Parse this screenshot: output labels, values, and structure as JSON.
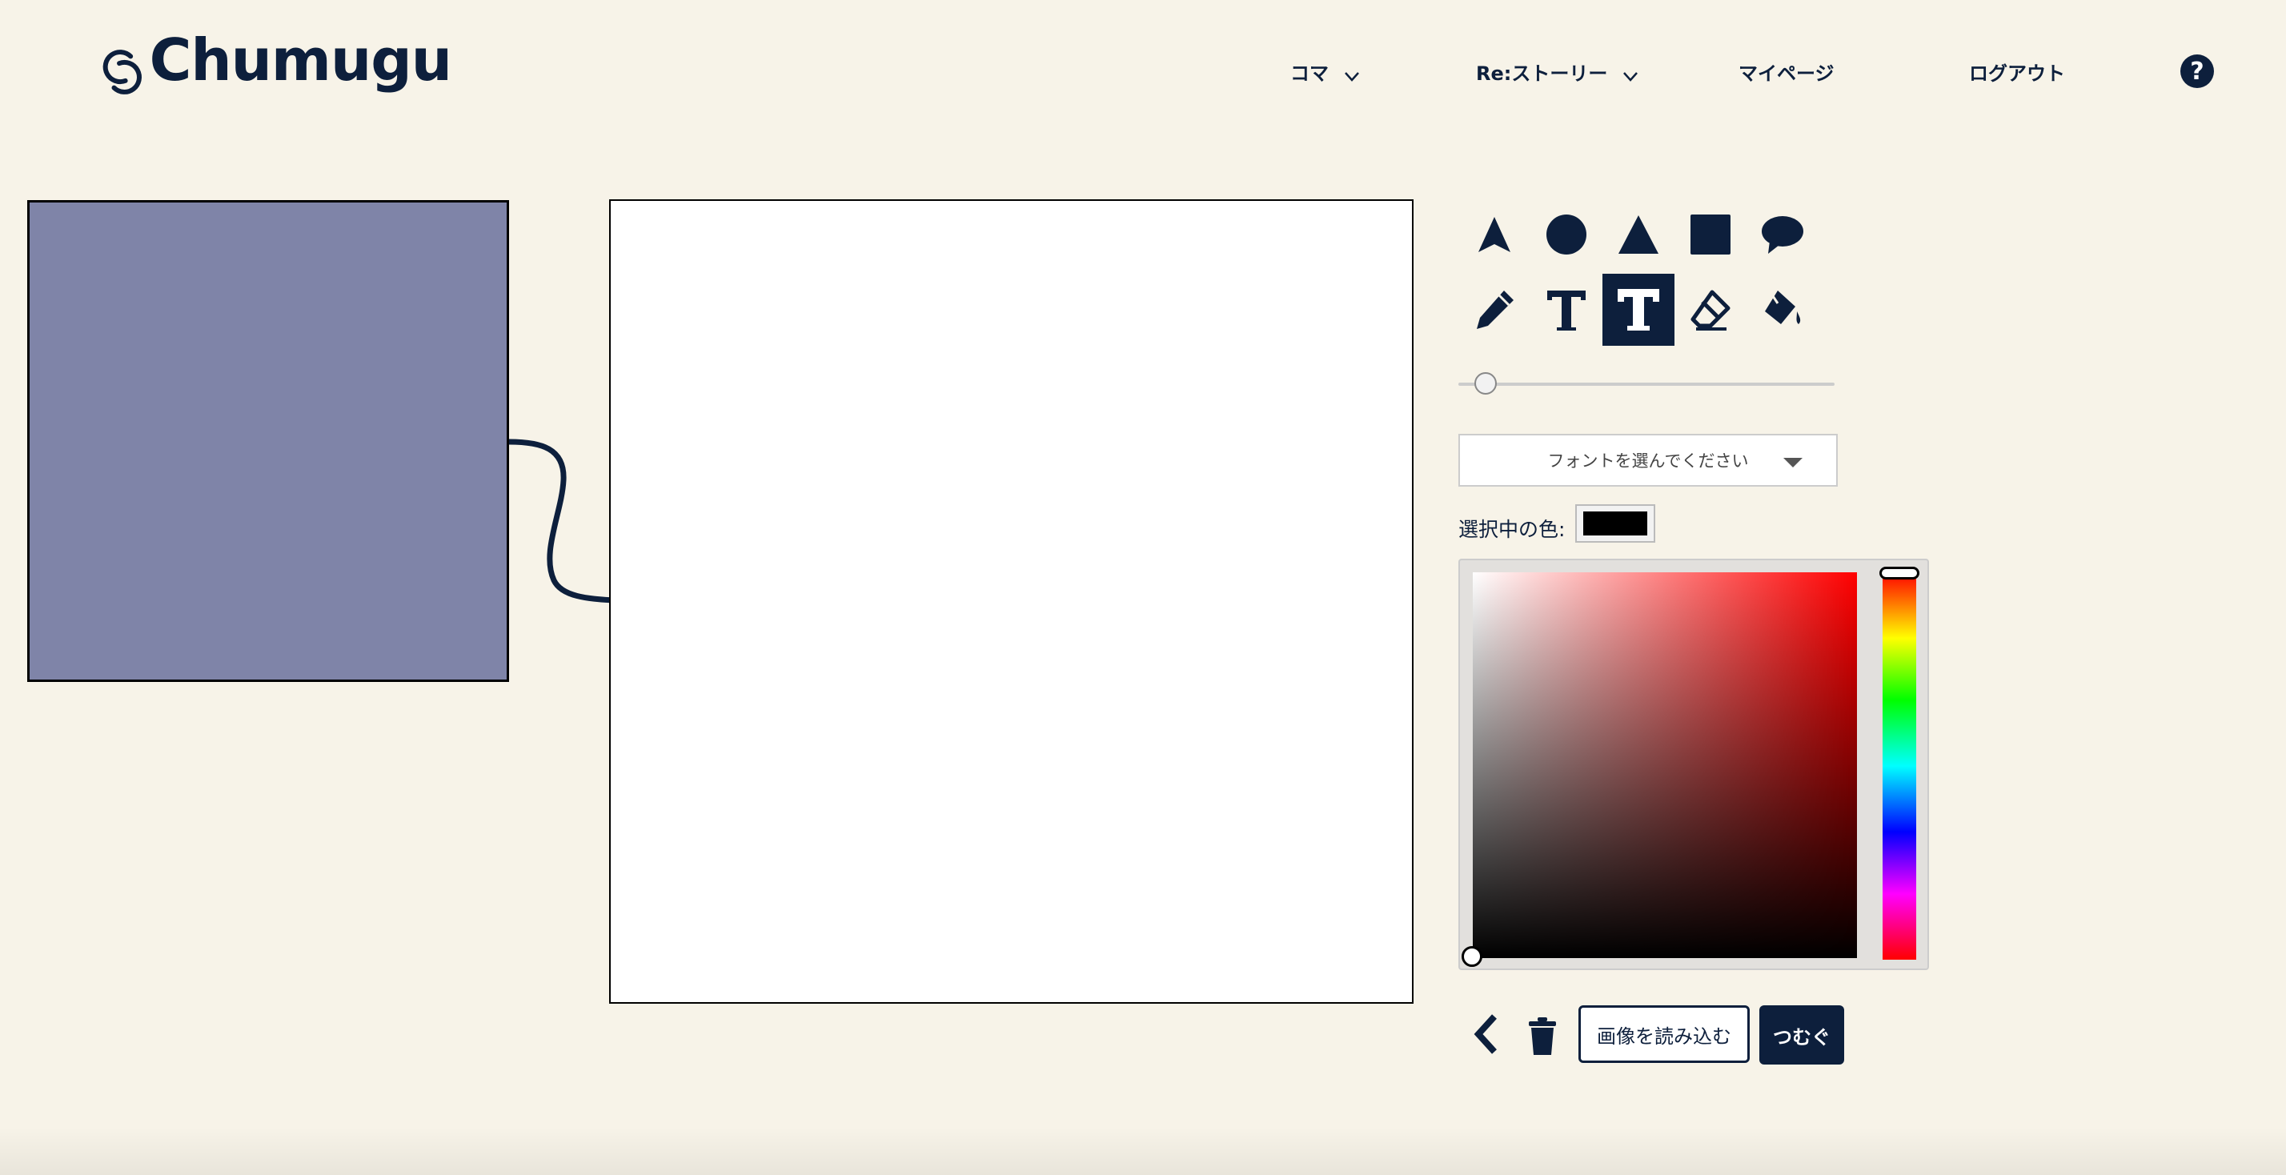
{
  "header": {
    "logo_text": "Chumugu",
    "nav": [
      {
        "label": "コマ",
        "has_dropdown": true
      },
      {
        "label": "Re:ストーリー",
        "has_dropdown": true
      },
      {
        "label": "マイページ",
        "has_dropdown": false
      },
      {
        "label": "ログアウト",
        "has_dropdown": false
      }
    ],
    "help_glyph": "?"
  },
  "colors": {
    "navy": "#0d1f3c",
    "background": "#f7f3e8",
    "thumbnail_fill": "#7f84a8",
    "selected_color": "#000000"
  },
  "tools": [
    {
      "name": "select-arrow-icon",
      "active": false
    },
    {
      "name": "circle-icon",
      "active": false
    },
    {
      "name": "triangle-icon",
      "active": false
    },
    {
      "name": "square-icon",
      "active": false
    },
    {
      "name": "speech-bubble-icon",
      "active": false
    },
    {
      "name": "pencil-icon",
      "active": false
    },
    {
      "name": "text-icon",
      "active": false
    },
    {
      "name": "text-bold-icon",
      "active": true
    },
    {
      "name": "eraser-icon",
      "active": false
    },
    {
      "name": "paint-bucket-icon",
      "active": false
    }
  ],
  "brush_size_fraction": 0.08,
  "font_select": {
    "placeholder": "フォントを選んでください"
  },
  "color": {
    "label": "選択中の色:"
  },
  "buttons": {
    "load_image": "画像を読み込む",
    "connect": "つむぐ"
  }
}
